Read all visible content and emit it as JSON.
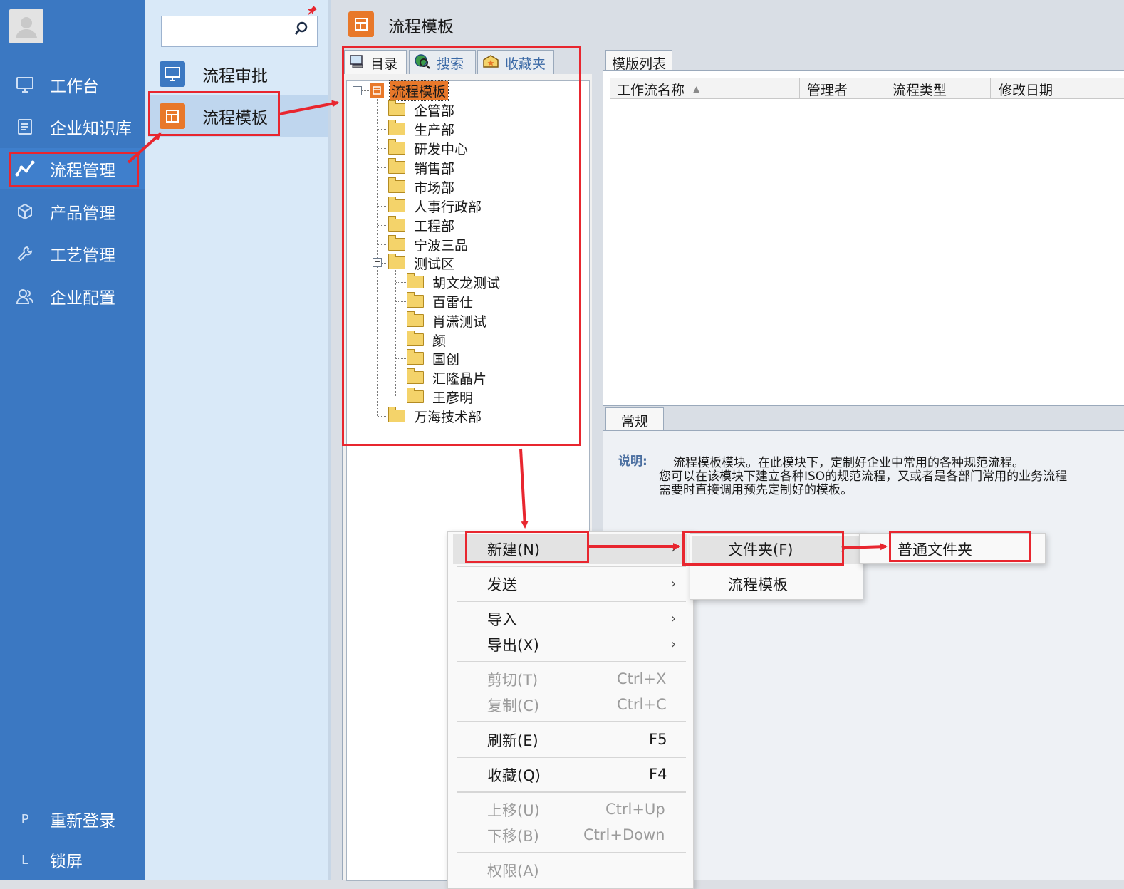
{
  "sidebar": {
    "items": [
      {
        "label": "工作台",
        "icon": "monitor-icon"
      },
      {
        "label": "企业知识库",
        "icon": "document-list-icon"
      },
      {
        "label": "流程管理",
        "icon": "process-chart-icon"
      },
      {
        "label": "产品管理",
        "icon": "cube-icon"
      },
      {
        "label": "工艺管理",
        "icon": "wrench-icon"
      },
      {
        "label": "企业配置",
        "icon": "users-icon"
      }
    ],
    "bottom": [
      {
        "letter": "P",
        "label": "重新登录"
      },
      {
        "letter": "L",
        "label": "锁屏"
      }
    ]
  },
  "subnav": {
    "search_placeholder": "",
    "items": [
      {
        "label": "流程审批",
        "icon": "monitor-icon"
      },
      {
        "label": "流程模板",
        "icon": "template-icon"
      }
    ]
  },
  "main": {
    "title": "流程模板",
    "left_tabs": [
      {
        "label": "目录",
        "icon": "catalog-icon"
      },
      {
        "label": "搜索",
        "icon": "globe-search-icon"
      },
      {
        "label": "收藏夹",
        "icon": "favorites-icon"
      }
    ],
    "tree": {
      "root": "流程模板",
      "children": [
        "企管部",
        "生产部",
        "研发中心",
        "销售部",
        "市场部",
        "人事行政部",
        "工程部",
        "宁波三品"
      ],
      "test_area": {
        "label": "测试区",
        "children": [
          "胡文龙测试",
          "百雷仕",
          "肖潇测试",
          "颜",
          "国创",
          "汇隆晶片",
          "王彦明"
        ]
      },
      "last": "万海技术部"
    },
    "list_tab": "模版列表",
    "columns": [
      "工作流名称",
      "管理者",
      "流程类型",
      "修改日期"
    ],
    "general_tab": "常规",
    "description": {
      "label": "说明:",
      "lines": [
        "流程模板模块。在此模块下，定制好企业中常用的各种规范流程。",
        "您可以在该模块下建立各种ISO的规范流程，又或者是各部门常用的业务流程",
        "需要时直接调用预先定制好的模板。"
      ]
    }
  },
  "context_menu": {
    "items": [
      {
        "label": "新建(N)",
        "submenu": true
      },
      {
        "label": "发送",
        "submenu": true
      },
      {
        "label": "导入",
        "submenu": true
      },
      {
        "label": "导出(X)",
        "submenu": true
      },
      {
        "label": "剪切(T)",
        "shortcut": "Ctrl+X",
        "disabled": true
      },
      {
        "label": "复制(C)",
        "shortcut": "Ctrl+C",
        "disabled": true
      },
      {
        "label": "刷新(E)",
        "shortcut": "F5"
      },
      {
        "label": "收藏(Q)",
        "shortcut": "F4"
      },
      {
        "label": "上移(U)",
        "shortcut": "Ctrl+Up",
        "disabled": true
      },
      {
        "label": "下移(B)",
        "shortcut": "Ctrl+Down",
        "disabled": true
      },
      {
        "label": "权限(A)",
        "disabled": true
      }
    ],
    "new_submenu": [
      "文件夹(F)",
      "流程模板"
    ],
    "folder_submenu": [
      "普通文件夹"
    ]
  },
  "colors": {
    "sidebar_bg": "#3b78c2",
    "subnav_bg": "#d9e9f8",
    "accent_orange": "#e8782a",
    "annotation_red": "#e8262f"
  }
}
